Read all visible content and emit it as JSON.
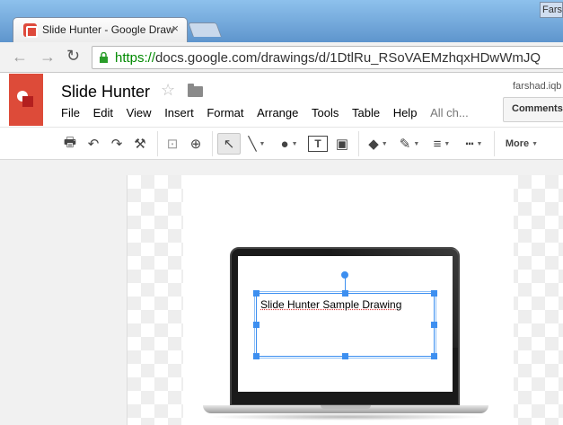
{
  "browser": {
    "tab_title": "Slide Hunter - Google Draw",
    "tab_close": "×",
    "user_label": "Fars",
    "nav": {
      "back": "←",
      "forward": "→",
      "reload": "↻"
    },
    "url_scheme": "https://",
    "url_rest": "docs.google.com/drawings/d/1DtlRu_RSoVAEMzhqxHDwWmJQ"
  },
  "docs": {
    "title": "Slide Hunter",
    "star": "☆",
    "account": "farshad.iqb",
    "comments_label": "Comments",
    "menu": [
      "File",
      "Edit",
      "View",
      "Insert",
      "Format",
      "Arrange",
      "Tools",
      "Table",
      "Help"
    ],
    "menu_status": "All ch..."
  },
  "toolbar": {
    "print": "🖶",
    "undo": "↶",
    "redo": "↷",
    "paint_format": "⚒",
    "zoom_fit": "⊡",
    "zoom": "⊕",
    "select": "↖",
    "line": "╲",
    "shape": "●",
    "textbox": "T",
    "image": "▣",
    "fill": "◆",
    "pen": "✎",
    "line_weight": "≡",
    "line_dash": "┅",
    "more_label": "More",
    "caret": "▼"
  },
  "canvas": {
    "textbox_text": "Slide Hunter Sample Drawing"
  },
  "colors": {
    "accent_red": "#dd4b39",
    "selection_blue": "#3d8ff0",
    "https_green": "#008a00"
  }
}
